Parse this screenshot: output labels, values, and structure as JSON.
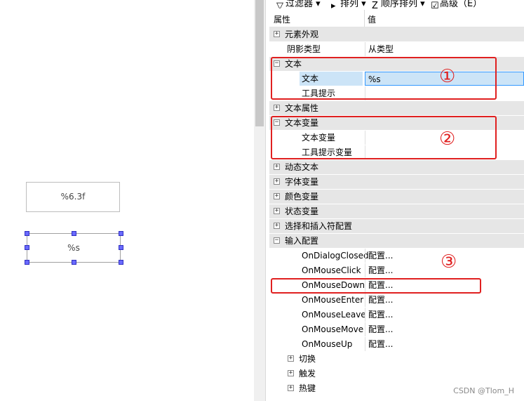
{
  "toolbar": {
    "filter": "过滤器",
    "sort": "排列",
    "order": "顺序排列",
    "advanced": "高级（E）"
  },
  "header": {
    "property": "属性",
    "value": "值"
  },
  "rows": [
    {
      "kind": "cat",
      "toggle": "+",
      "name": "元素外观",
      "value": ""
    },
    {
      "kind": "top",
      "name": "阴影类型",
      "value": "从类型"
    },
    {
      "kind": "cat",
      "toggle": "−",
      "name": "文本",
      "value": ""
    },
    {
      "kind": "sel",
      "name": "文本",
      "value": "%s"
    },
    {
      "kind": "prop",
      "name": "工具提示",
      "value": ""
    },
    {
      "kind": "cat",
      "toggle": "+",
      "name": "文本属性",
      "value": ""
    },
    {
      "kind": "cat",
      "toggle": "−",
      "name": "文本变量",
      "value": ""
    },
    {
      "kind": "prop",
      "name": "文本变量",
      "value": ""
    },
    {
      "kind": "prop",
      "name": "工具提示变量",
      "value": ""
    },
    {
      "kind": "cat",
      "toggle": "+",
      "name": "动态文本",
      "value": ""
    },
    {
      "kind": "cat",
      "toggle": "+",
      "name": "字体变量",
      "value": ""
    },
    {
      "kind": "cat",
      "toggle": "+",
      "name": "颜色变量",
      "value": ""
    },
    {
      "kind": "cat",
      "toggle": "+",
      "name": "状态变量",
      "value": ""
    },
    {
      "kind": "cat",
      "toggle": "+",
      "name": "选择和插入符配置",
      "value": ""
    },
    {
      "kind": "cat",
      "toggle": "−",
      "name": "输入配置",
      "value": ""
    },
    {
      "kind": "prop",
      "name": "OnDialogClosed",
      "value": "配置..."
    },
    {
      "kind": "prop",
      "name": "OnMouseClick",
      "value": "配置..."
    },
    {
      "kind": "prop",
      "name": "OnMouseDown",
      "value": "配置..."
    },
    {
      "kind": "prop",
      "name": "OnMouseEnter",
      "value": "配置..."
    },
    {
      "kind": "prop",
      "name": "OnMouseLeave",
      "value": "配置..."
    },
    {
      "kind": "prop",
      "name": "OnMouseMove",
      "value": "配置..."
    },
    {
      "kind": "prop",
      "name": "OnMouseUp",
      "value": "配置..."
    },
    {
      "kind": "sub",
      "toggle": "+",
      "name": "切换",
      "value": ""
    },
    {
      "kind": "sub",
      "toggle": "+",
      "name": "触发",
      "value": ""
    },
    {
      "kind": "sub",
      "toggle": "+",
      "name": "热键",
      "value": ""
    }
  ],
  "annotations": [
    "①",
    "②",
    "③"
  ],
  "canvas": {
    "box1_text": "%6.3f",
    "box2_text": "%s"
  },
  "watermark": "CSDN @Tlom_H",
  "colors": {
    "highlight": "#e02020",
    "selection": "#cce4f7",
    "handle": "#6a6aff"
  }
}
